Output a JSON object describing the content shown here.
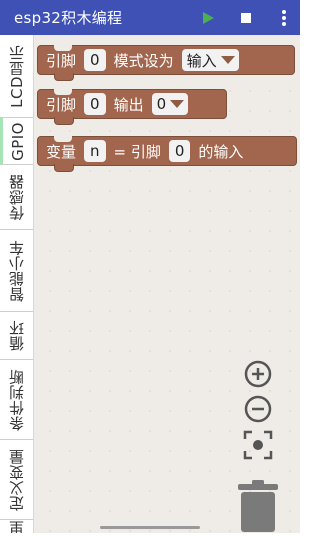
{
  "app": {
    "title": "esp32积木编程"
  },
  "toolbar": {
    "play_icon": "play-icon",
    "stop_icon": "stop-icon",
    "menu_icon": "more-vertical-icon",
    "accent": "#3f51b5",
    "play_color": "#4caf50"
  },
  "categories": [
    {
      "label": "LCD显示",
      "color": "#5c81a6"
    },
    {
      "label": "GPIO",
      "color": "#a5e4b5",
      "selected": true
    },
    {
      "label": "传感器",
      "color": "#9a5ca6"
    },
    {
      "label": "智能小车",
      "color": "#5ca65c"
    },
    {
      "label": "循环",
      "color": "#5ca65c"
    },
    {
      "label": "条件判断",
      "color": "#5c81a6"
    },
    {
      "label": "定义变量",
      "color": "#a55b80"
    },
    {
      "label": "里",
      "color": "#a5745b"
    }
  ],
  "blocks": {
    "block1": {
      "t1": "引脚",
      "pin": "0",
      "t2": "模式设为",
      "mode": "输入"
    },
    "block2": {
      "t1": "引脚",
      "pin": "0",
      "t2": "输出",
      "value": "0"
    },
    "block3": {
      "t1": "变量",
      "var": "n",
      "t2": "= 引脚",
      "pin": "0",
      "t3": "的输入"
    },
    "color": "#a1664d"
  },
  "controls": {
    "zoom_in": "zoom-in-icon",
    "zoom_out": "zoom-out-icon",
    "recenter": "recenter-icon",
    "trash": "trash-icon"
  }
}
